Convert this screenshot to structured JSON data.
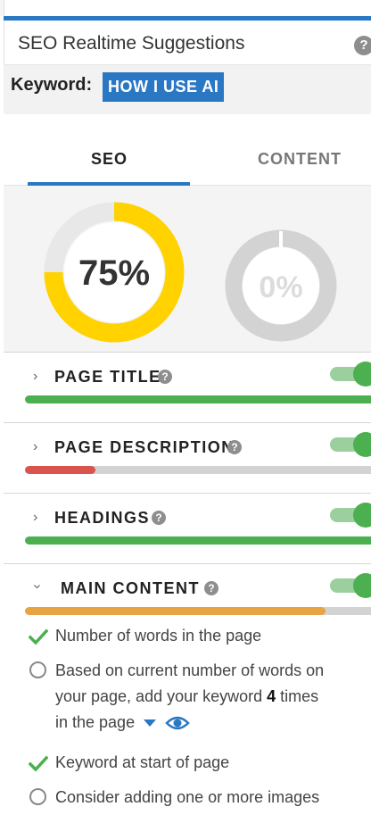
{
  "header": {
    "title": "SEO Realtime Suggestions",
    "help": "?"
  },
  "keyword": {
    "label": "Keyword:",
    "value": "HOW I USE AI"
  },
  "tabs": [
    {
      "label": "SEO",
      "active": true
    },
    {
      "label": "CONTENT",
      "active": false
    }
  ],
  "gauges": {
    "seo": {
      "text": "75%",
      "value": 75,
      "color": "#ffd200"
    },
    "content": {
      "text": "0%",
      "value": 0,
      "color": "#d3d3d3"
    }
  },
  "sections": [
    {
      "title": "PAGE TITLE",
      "chevron": "›",
      "progress": 100,
      "color": "#4caf50",
      "enabled": true
    },
    {
      "title": "PAGE DESCRIPTION",
      "chevron": "›",
      "progress": 20,
      "color": "#d9534f",
      "enabled": true
    },
    {
      "title": "HEADINGS",
      "chevron": "›",
      "progress": 100,
      "color": "#4caf50",
      "enabled": true
    },
    {
      "title": "MAIN CONTENT",
      "chevron": "‹",
      "progress": 85,
      "color": "#e8a443",
      "enabled": true
    }
  ],
  "main_content_items": [
    {
      "status": "check",
      "text": "Number of words in the page"
    },
    {
      "status": "todo",
      "line1": "Based on current number of words on",
      "line2_pre": "your page, add your keyword ",
      "line2_bold": "4",
      "line2_post": " times",
      "line3": "in the page"
    },
    {
      "status": "check",
      "text": "Keyword at start of page"
    },
    {
      "status": "todo",
      "text": "Consider adding one or more images"
    }
  ],
  "colors": {
    "accent": "#2a78c4",
    "success": "#4caf50",
    "danger": "#d9534f",
    "warning": "#e8a443",
    "gauge": "#ffd200"
  }
}
